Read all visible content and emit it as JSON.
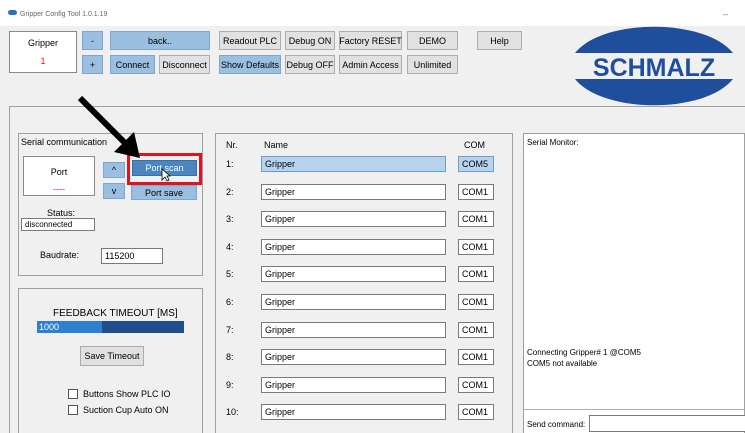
{
  "window": {
    "title": "Gripper Config Tool 1.0.1.19",
    "minimize_glyph": "–"
  },
  "device_box": {
    "label": "Gripper",
    "value": "1"
  },
  "toolbar": {
    "minus": "-",
    "plus": "+",
    "back": "back..",
    "connect": "Connect",
    "disconnect": "Disconnect",
    "readout_plc": "Readout PLC",
    "debug_on": "Debug ON",
    "factory_reset": "Factory RESET",
    "demo": "DEMO",
    "help": "Help",
    "show_defaults": "Show Defaults",
    "debug_off": "Debug OFF",
    "admin_access": "Admin Access",
    "unlimited": "Unlimited"
  },
  "logo": {
    "text": "SCHMALZ",
    "brand_color": "#1f4e9c"
  },
  "serial": {
    "title": "Serial communication",
    "port_label": "Port",
    "port_value": "----",
    "up": "^",
    "down": "v",
    "port_scan": "Port scan",
    "port_save": "Port save",
    "status_label": "Status:",
    "status_value": "disconnected",
    "baudrate_label": "Baudrate:",
    "baudrate_value": "115200"
  },
  "feedback": {
    "title": "FEEDBACK TIMEOUT [MS]",
    "value": "1000",
    "fill_fraction": 0.44,
    "save_label": "Save Timeout",
    "check1_label": "Buttons Show PLC IO",
    "check2_label": "Suction Cup Auto ON"
  },
  "table": {
    "headers": {
      "nr": "Nr.",
      "name": "Name",
      "com": "COM"
    },
    "rows": [
      {
        "nr": "1:",
        "name": "Gripper",
        "com": "COM5",
        "selected": true
      },
      {
        "nr": "2:",
        "name": "Gripper",
        "com": "COM1",
        "selected": false
      },
      {
        "nr": "3:",
        "name": "Gripper",
        "com": "COM1",
        "selected": false
      },
      {
        "nr": "4:",
        "name": "Gripper",
        "com": "COM1",
        "selected": false
      },
      {
        "nr": "5:",
        "name": "Gripper",
        "com": "COM1",
        "selected": false
      },
      {
        "nr": "6:",
        "name": "Gripper",
        "com": "COM1",
        "selected": false
      },
      {
        "nr": "7:",
        "name": "Gripper",
        "com": "COM1",
        "selected": false
      },
      {
        "nr": "8:",
        "name": "Gripper",
        "com": "COM1",
        "selected": false
      },
      {
        "nr": "9:",
        "name": "Gripper",
        "com": "COM1",
        "selected": false
      },
      {
        "nr": "10:",
        "name": "Gripper",
        "com": "COM1",
        "selected": false
      }
    ]
  },
  "monitor": {
    "title": "Serial Monitor:",
    "line1": "Connecting Gripper# 1 @COM5",
    "line2": "COM5 not available",
    "send_label": "Send command:"
  },
  "colors": {
    "highlight_red": "#e0141e",
    "selection_blue": "#4a86c0"
  }
}
